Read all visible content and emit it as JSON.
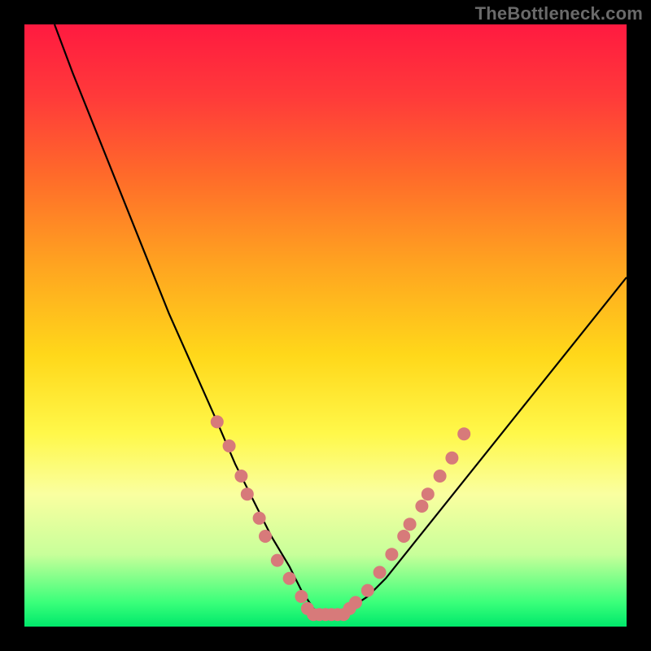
{
  "watermark": "TheBottleneck.com",
  "chart_data": {
    "type": "line",
    "title": "",
    "xlabel": "",
    "ylabel": "",
    "xlim": [
      0,
      100
    ],
    "ylim": [
      0,
      100
    ],
    "grid": false,
    "legend": false,
    "background_gradient": {
      "direction": "vertical",
      "stops": [
        {
          "pos": 0.0,
          "color": "#ff1a40"
        },
        {
          "pos": 0.12,
          "color": "#ff3a3a"
        },
        {
          "pos": 0.25,
          "color": "#ff6a2a"
        },
        {
          "pos": 0.4,
          "color": "#ffa420"
        },
        {
          "pos": 0.55,
          "color": "#ffd81a"
        },
        {
          "pos": 0.68,
          "color": "#fff84a"
        },
        {
          "pos": 0.78,
          "color": "#faffa0"
        },
        {
          "pos": 0.88,
          "color": "#c8ff9a"
        },
        {
          "pos": 0.96,
          "color": "#3aff7a"
        },
        {
          "pos": 1.0,
          "color": "#00e86b"
        }
      ]
    },
    "series": [
      {
        "name": "bottleneck-curve",
        "color": "#000000",
        "x": [
          5,
          8,
          12,
          16,
          20,
          24,
          28,
          32,
          35,
          38,
          41,
          44,
          46,
          48,
          50,
          52,
          54,
          57,
          60,
          64,
          68,
          72,
          76,
          80,
          84,
          88,
          92,
          96,
          100
        ],
        "y": [
          100,
          92,
          82,
          72,
          62,
          52,
          43,
          34,
          27,
          21,
          15,
          10,
          6,
          3,
          2,
          2,
          3,
          5,
          8,
          13,
          18,
          23,
          28,
          33,
          38,
          43,
          48,
          53,
          58
        ]
      }
    ],
    "markers": {
      "name": "highlight-dots",
      "color": "#d77a7a",
      "radius": 8,
      "points": [
        {
          "x": 32,
          "y": 34
        },
        {
          "x": 34,
          "y": 30
        },
        {
          "x": 36,
          "y": 25
        },
        {
          "x": 37,
          "y": 22
        },
        {
          "x": 39,
          "y": 18
        },
        {
          "x": 40,
          "y": 15
        },
        {
          "x": 42,
          "y": 11
        },
        {
          "x": 44,
          "y": 8
        },
        {
          "x": 46,
          "y": 5
        },
        {
          "x": 47,
          "y": 3
        },
        {
          "x": 48,
          "y": 2
        },
        {
          "x": 49,
          "y": 2
        },
        {
          "x": 50,
          "y": 2
        },
        {
          "x": 51,
          "y": 2
        },
        {
          "x": 52,
          "y": 2
        },
        {
          "x": 53,
          "y": 2
        },
        {
          "x": 54,
          "y": 3
        },
        {
          "x": 55,
          "y": 4
        },
        {
          "x": 57,
          "y": 6
        },
        {
          "x": 59,
          "y": 9
        },
        {
          "x": 61,
          "y": 12
        },
        {
          "x": 63,
          "y": 15
        },
        {
          "x": 64,
          "y": 17
        },
        {
          "x": 66,
          "y": 20
        },
        {
          "x": 67,
          "y": 22
        },
        {
          "x": 69,
          "y": 25
        },
        {
          "x": 71,
          "y": 28
        },
        {
          "x": 73,
          "y": 32
        }
      ]
    }
  }
}
